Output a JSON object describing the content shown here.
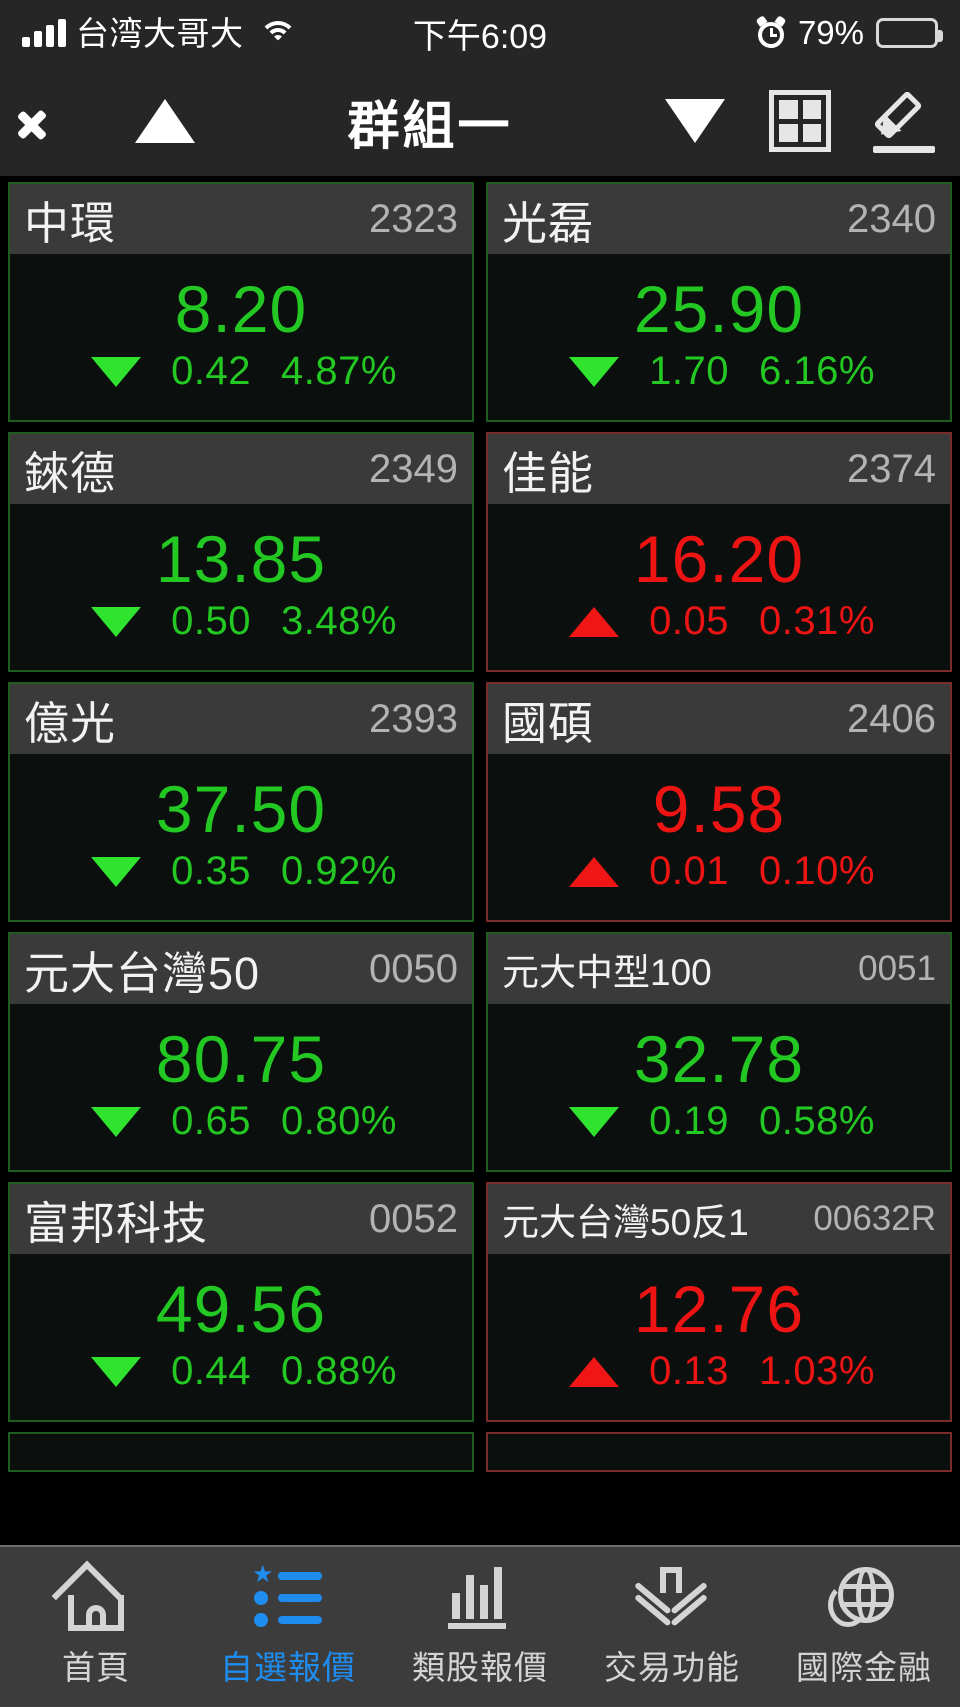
{
  "statusbar": {
    "carrier": "台湾大哥大",
    "time": "下午6:09",
    "battery_percent": "79%",
    "battery_level": 79,
    "signal_icon": "signal-bars-icon",
    "wifi_icon": "wifi-icon",
    "alarm_icon": "alarm-clock-icon"
  },
  "navbar": {
    "back_icon": "back-chevron-icon",
    "prev_group_icon": "triangle-up-icon",
    "title": "群組一",
    "next_group_icon": "triangle-down-icon",
    "layout_icon": "grid-layout-icon",
    "edit_icon": "pencil-edit-icon"
  },
  "colors": {
    "up": "#ef1414",
    "down": "#23c823",
    "accent": "#1f8cf0",
    "header_bg": "#3a3a3a",
    "card_bg": "#0b0f0e"
  },
  "quotes": [
    {
      "name": "中環",
      "code": "2323",
      "price": "8.20",
      "direction": "down",
      "arrow": "▼",
      "change": "0.42",
      "percent": "4.87%"
    },
    {
      "name": "光磊",
      "code": "2340",
      "price": "25.90",
      "direction": "down",
      "arrow": "▼",
      "change": "1.70",
      "percent": "6.16%"
    },
    {
      "name": "錸德",
      "code": "2349",
      "price": "13.85",
      "direction": "down",
      "arrow": "▼",
      "change": "0.50",
      "percent": "3.48%"
    },
    {
      "name": "佳能",
      "code": "2374",
      "price": "16.20",
      "direction": "up",
      "arrow": "▲",
      "change": "0.05",
      "percent": "0.31%"
    },
    {
      "name": "億光",
      "code": "2393",
      "price": "37.50",
      "direction": "down",
      "arrow": "▼",
      "change": "0.35",
      "percent": "0.92%"
    },
    {
      "name": "國碩",
      "code": "2406",
      "price": "9.58",
      "direction": "up",
      "arrow": "▲",
      "change": "0.01",
      "percent": "0.10%"
    },
    {
      "name": "元大台灣50",
      "code": "0050",
      "price": "80.75",
      "direction": "down",
      "arrow": "▼",
      "change": "0.65",
      "percent": "0.80%"
    },
    {
      "name": "元大中型100",
      "code": "0051",
      "price": "32.78",
      "direction": "down",
      "arrow": "▼",
      "change": "0.19",
      "percent": "0.58%"
    },
    {
      "name": "富邦科技",
      "code": "0052",
      "price": "49.56",
      "direction": "down",
      "arrow": "▼",
      "change": "0.44",
      "percent": "0.88%"
    },
    {
      "name": "元大台灣50反1",
      "code": "00632R",
      "price": "12.76",
      "direction": "up",
      "arrow": "▲",
      "change": "0.13",
      "percent": "1.03%"
    }
  ],
  "tabbar": {
    "items": [
      {
        "label": "首頁",
        "icon": "home-icon",
        "active": false
      },
      {
        "label": "自選報價",
        "icon": "star-list-icon",
        "active": true
      },
      {
        "label": "類股報價",
        "icon": "bar-chart-icon",
        "active": false
      },
      {
        "label": "交易功能",
        "icon": "download-arrow-icon",
        "active": false
      },
      {
        "label": "國際金融",
        "icon": "globe-icon",
        "active": false
      }
    ]
  }
}
